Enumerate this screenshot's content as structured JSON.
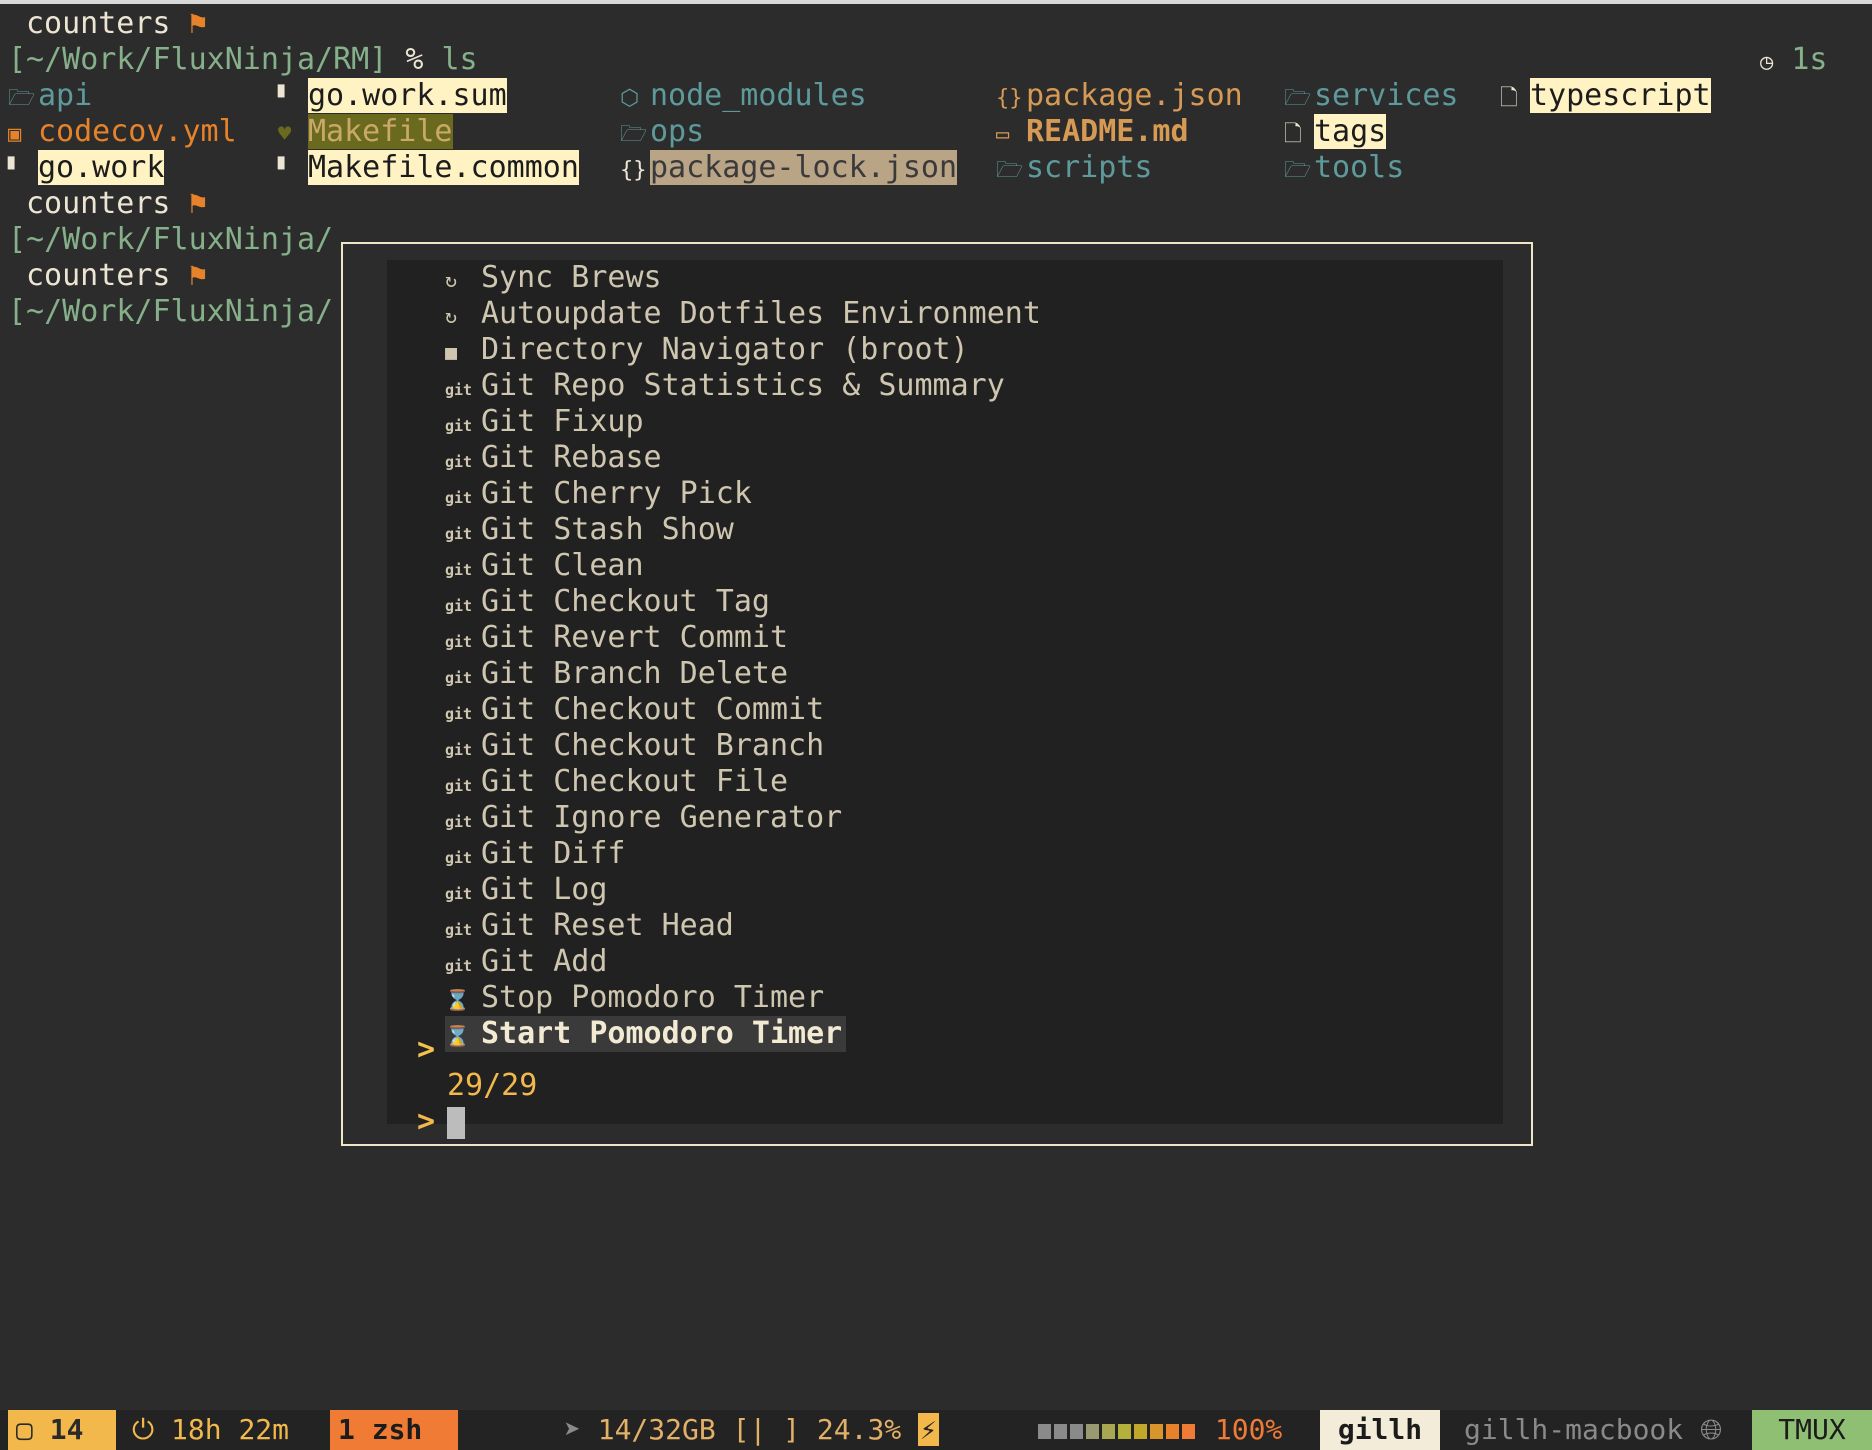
{
  "terminal": {
    "header_word": "counters",
    "flag_glyph": "⚑",
    "prompt_path_full": "[~/Work/FluxNinja/RM]",
    "prompt_symbol": "%",
    "command": "ls",
    "duration": "1s",
    "path_partial": "[~/Work/FluxNinja/",
    "files": [
      {
        "name": "api",
        "icon": "folder-icon",
        "style": "teal"
      },
      {
        "name": "codecov.yml",
        "icon": "yaml-icon",
        "style": "orange"
      },
      {
        "name": "go.work",
        "icon": "file-icon",
        "style": "cream"
      },
      {
        "name": "go.work.sum",
        "icon": "file-icon",
        "style": "cream"
      },
      {
        "name": "Makefile",
        "icon": "makefile-icon",
        "style": "olive"
      },
      {
        "name": "Makefile.common",
        "icon": "file-icon",
        "style": "cream"
      },
      {
        "name": "node_modules",
        "icon": "node-icon",
        "style": "teal"
      },
      {
        "name": "ops",
        "icon": "folder-icon",
        "style": "teal"
      },
      {
        "name": "package-lock.json",
        "icon": "json-icon",
        "style": "taupe"
      },
      {
        "name": "package.json",
        "icon": "json-icon",
        "style": "tan"
      },
      {
        "name": "README.md",
        "icon": "markdown-icon",
        "style": "tan-bold"
      },
      {
        "name": "scripts",
        "icon": "folder-icon",
        "style": "teal"
      },
      {
        "name": "services",
        "icon": "folder-icon",
        "style": "teal"
      },
      {
        "name": "tags",
        "icon": "file-icon",
        "style": "cream"
      },
      {
        "name": "tools",
        "icon": "folder-icon",
        "style": "teal"
      },
      {
        "name": "typescript",
        "icon": "file-icon",
        "style": "cream"
      }
    ]
  },
  "palette": {
    "items": [
      {
        "label": "Sync Brews",
        "icon": "refresh-icon"
      },
      {
        "label": "Autoupdate Dotfiles Environment",
        "icon": "refresh-icon"
      },
      {
        "label": "Directory Navigator (broot)",
        "icon": "folder-icon"
      },
      {
        "label": "Git Repo Statistics & Summary",
        "icon": "git-icon"
      },
      {
        "label": "Git Fixup",
        "icon": "git-icon"
      },
      {
        "label": "Git Rebase",
        "icon": "git-icon"
      },
      {
        "label": "Git Cherry Pick",
        "icon": "git-icon"
      },
      {
        "label": "Git Stash Show",
        "icon": "git-icon"
      },
      {
        "label": "Git Clean",
        "icon": "git-icon"
      },
      {
        "label": "Git Checkout Tag",
        "icon": "git-icon"
      },
      {
        "label": "Git Revert Commit",
        "icon": "git-icon"
      },
      {
        "label": "Git Branch Delete",
        "icon": "git-icon"
      },
      {
        "label": "Git Checkout Commit",
        "icon": "git-icon"
      },
      {
        "label": "Git Checkout Branch",
        "icon": "git-icon"
      },
      {
        "label": "Git Checkout File",
        "icon": "git-icon"
      },
      {
        "label": "Git Ignore Generator",
        "icon": "git-icon"
      },
      {
        "label": "Git Diff",
        "icon": "git-icon"
      },
      {
        "label": "Git Log",
        "icon": "git-icon"
      },
      {
        "label": "Git Reset Head",
        "icon": "git-icon"
      },
      {
        "label": "Git Add",
        "icon": "git-icon"
      },
      {
        "label": "Stop Pomodoro Timer",
        "icon": "hourglass-icon"
      },
      {
        "label": "Start Pomodoro Timer",
        "icon": "hourglass-icon"
      }
    ],
    "selected_marker": ">",
    "match_count": "29/29",
    "query_prompt": ">",
    "query_value": ""
  },
  "statusbar": {
    "window_count": "14",
    "uptime": "18h 22m",
    "window_label": "1 zsh",
    "memory": "14/32GB",
    "cpu_bar_left": "[|",
    "cpu_bar_right": "]",
    "cpu_percent": "24.3%",
    "battery_percent": "100%",
    "battery_level": 1.0,
    "user": "gillh",
    "host": "gillh-macbook",
    "tmux": "TMUX"
  }
}
